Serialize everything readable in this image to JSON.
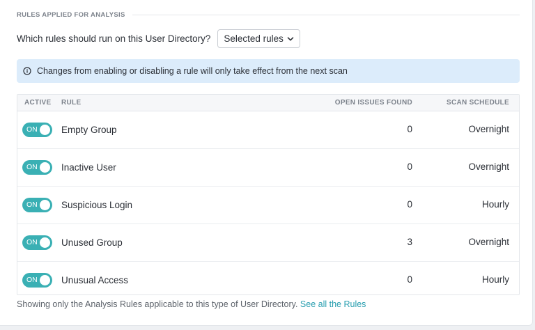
{
  "section": {
    "title": "RULES APPLIED FOR ANALYSIS"
  },
  "rule_selection": {
    "question": "Which rules should run on this User Directory?",
    "selected_value": "Selected rules"
  },
  "info_banner": {
    "icon": "info-icon",
    "text": "Changes from enabling or disabling a rule will only take effect from the next scan"
  },
  "table": {
    "headers": {
      "active": "ACTIVE",
      "rule": "RULE",
      "open_issues": "OPEN ISSUES FOUND",
      "scan_schedule": "SCAN SCHEDULE"
    },
    "rows": [
      {
        "toggle": "ON",
        "rule": "Empty Group",
        "open_issues": "0",
        "schedule": "Overnight"
      },
      {
        "toggle": "ON",
        "rule": "Inactive User",
        "open_issues": "0",
        "schedule": "Overnight"
      },
      {
        "toggle": "ON",
        "rule": "Suspicious Login",
        "open_issues": "0",
        "schedule": "Hourly"
      },
      {
        "toggle": "ON",
        "rule": "Unused Group",
        "open_issues": "3",
        "schedule": "Overnight"
      },
      {
        "toggle": "ON",
        "rule": "Unusual Access",
        "open_issues": "0",
        "schedule": "Hourly"
      }
    ]
  },
  "footer": {
    "text": "Showing only the Analysis Rules applicable to this type of User Directory.",
    "link": "See all the Rules"
  },
  "colors": {
    "accent": "#3ab0b4",
    "link": "#2a9fb0",
    "info_background": "#dcecfb"
  }
}
